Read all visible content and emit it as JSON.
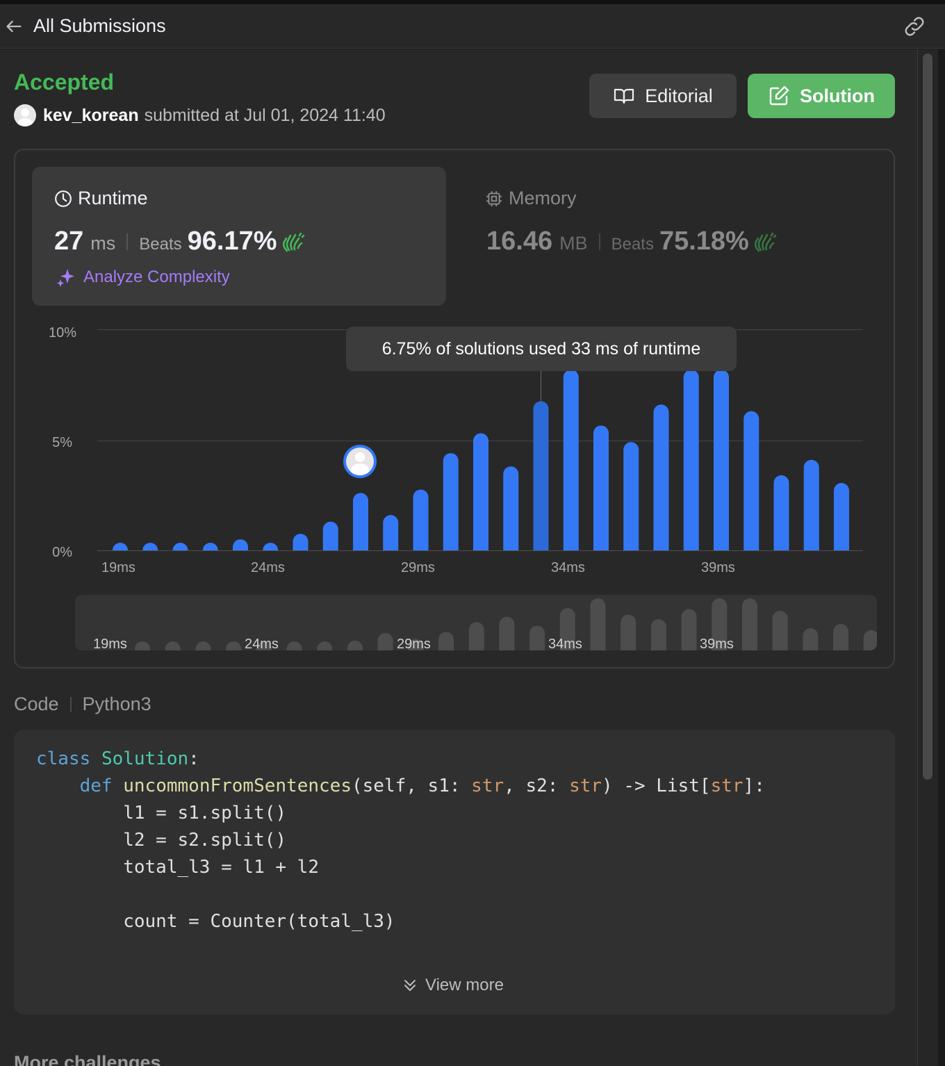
{
  "header": {
    "back_label": "All Submissions"
  },
  "submission": {
    "status": "Accepted",
    "username": "kev_korean",
    "submitted_text": "submitted at Jul 01, 2024 11:40"
  },
  "buttons": {
    "editorial": "Editorial",
    "solution": "Solution"
  },
  "runtime": {
    "title": "Runtime",
    "value": "27",
    "unit": "ms",
    "beats_label": "Beats",
    "beats_value": "96.17%",
    "analyze_label": "Analyze Complexity"
  },
  "memory": {
    "title": "Memory",
    "value": "16.46",
    "unit": "MB",
    "beats_label": "Beats",
    "beats_value": "75.18%"
  },
  "tooltip": "6.75% of solutions used 33 ms of runtime",
  "colors": {
    "accepted": "#45b957",
    "bar": "#3478f6",
    "bar_active": "#2c6ad8",
    "analyze": "#a57cf8",
    "solution_btn": "#5bb665"
  },
  "chart_data": {
    "type": "bar",
    "xlabel": "",
    "ylabel": "",
    "ylim": [
      0,
      10
    ],
    "yticks": [
      "10%",
      "5%",
      "0%"
    ],
    "xticks": [
      "19ms",
      "24ms",
      "29ms",
      "34ms",
      "39ms"
    ],
    "categories": [
      "19ms",
      "20ms",
      "21ms",
      "22ms",
      "23ms",
      "24ms",
      "25ms",
      "26ms",
      "27ms",
      "28ms",
      "29ms",
      "30ms",
      "31ms",
      "32ms",
      "33ms",
      "34ms",
      "35ms",
      "36ms",
      "37ms",
      "38ms",
      "39ms",
      "40ms",
      "41ms",
      "42ms",
      "43ms"
    ],
    "values": [
      0.3,
      0.3,
      0.3,
      0.3,
      0.5,
      0.3,
      0.75,
      1.3,
      2.6,
      1.6,
      2.75,
      4.4,
      5.3,
      3.8,
      6.75,
      8.4,
      5.65,
      4.9,
      6.6,
      8.4,
      8.4,
      6.3,
      3.4,
      4.1,
      3.05
    ],
    "highlighted_category": "33ms",
    "user_category": "27ms",
    "grid": true
  },
  "mini_chart": {
    "xticks": [
      "19ms",
      "24ms",
      "29ms",
      "34ms",
      "39ms"
    ]
  },
  "code": {
    "label": "Code",
    "language": "Python3",
    "view_more": "View more"
  },
  "more_challenges": "More challenges"
}
